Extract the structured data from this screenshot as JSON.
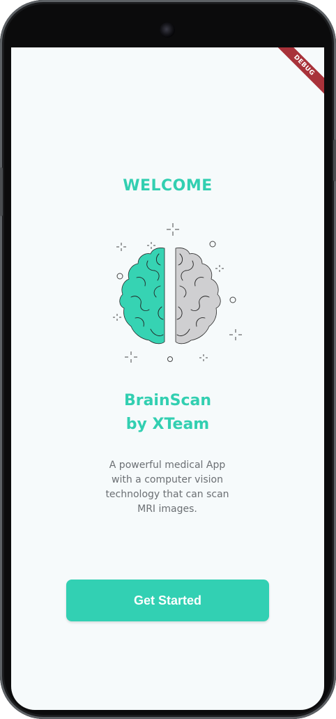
{
  "debug_banner": "DEBUG",
  "welcome_title": "WELCOME",
  "app_name_line1": "BrainScan",
  "app_name_line2": "by XTeam",
  "description": "A powerful medical App with a computer vision technology that can scan MRI images.",
  "cta_label": "Get Started",
  "colors": {
    "accent": "#32cfb1",
    "button": "#32d0b3",
    "brain_left": "#36d3b3",
    "brain_right": "#cfcfd1",
    "background": "#f6fafb",
    "body_text": "#6b6f73",
    "debug_ribbon": "#a8323a"
  },
  "icons": [
    "brain-icon",
    "sparkle-icon",
    "circle-dot-icon"
  ]
}
